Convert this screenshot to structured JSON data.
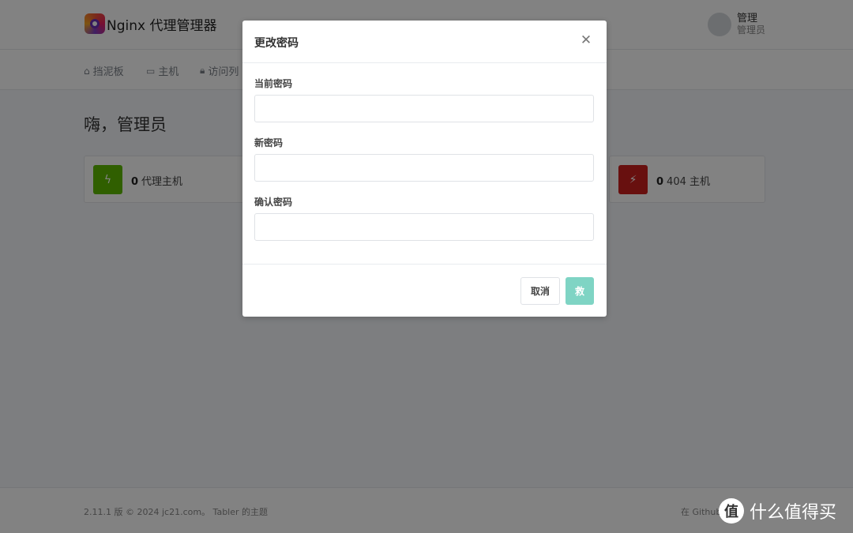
{
  "app": {
    "title": "Nginx 代理管理器",
    "logo_icon": "nginx-proxy-manager-logo"
  },
  "user": {
    "name": "管理",
    "role": "管理员"
  },
  "nav": [
    {
      "label": "挡泥板",
      "icon": "home-icon"
    },
    {
      "label": "主机",
      "icon": "monitor-icon"
    },
    {
      "label": "访问列",
      "icon": "lock-icon"
    }
  ],
  "main": {
    "greeting": "嗨，管理员",
    "stats": [
      {
        "count": "0",
        "label": "代理主机",
        "color": "#5eba00",
        "icon": "bolt-icon"
      },
      {
        "count": "0",
        "label": "404 主机",
        "color": "#cd201f",
        "icon": "zap-off-icon"
      }
    ]
  },
  "footer": {
    "left": "2.11.1 版 © 2024 jc21.com。 Tabler 的主题",
    "right": "在 Github"
  },
  "watermark": {
    "badge": "值",
    "text": "什么值得买"
  },
  "modal": {
    "title": "更改密码",
    "close_icon": "close-icon",
    "fields": [
      {
        "label": "当前密码",
        "value": ""
      },
      {
        "label": "新密码",
        "value": ""
      },
      {
        "label": "确认密码",
        "value": ""
      }
    ],
    "cancel_label": "取消",
    "save_label": "救"
  }
}
